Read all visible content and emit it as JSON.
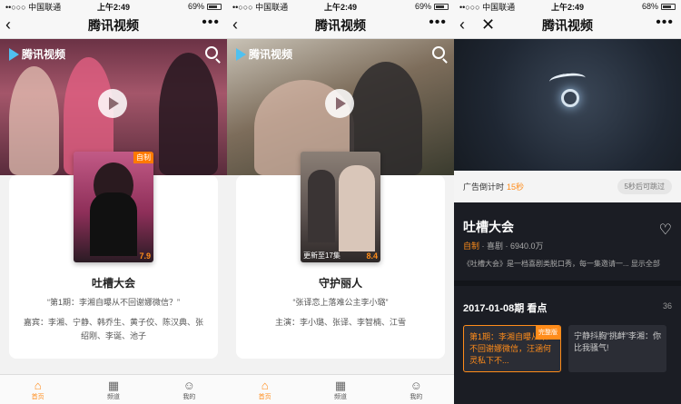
{
  "statusbar": {
    "s1": {
      "carrier": "••○○○ 中国联通",
      "time": "上午2:49",
      "battery": "69%"
    },
    "s2": {
      "carrier": "••○○○ 中国联通",
      "time": "上午2:49",
      "battery": "69%"
    },
    "s3": {
      "carrier": "••○○○ 中国联通",
      "time": "上午2:49",
      "battery": "68%"
    }
  },
  "nav": {
    "title": "腾讯视频",
    "back": "‹",
    "close": "✕",
    "more": "•••"
  },
  "brand": {
    "logo_text": "腾讯视频"
  },
  "screen1": {
    "poster_tag": "自制",
    "poster_score": "7.9",
    "show_name": "吐槽大会",
    "quote": "“第1期：李湘自曝从不回谢娜微信？”",
    "guests": "嘉宾：李湘、宁静、韩乔生、黄子佼、陈汉典、张绍刚、李诞、池子"
  },
  "screen2": {
    "poster_update": "更新至17集",
    "poster_score": "8.4",
    "show_name": "守护丽人",
    "quote": "“张译恋上落难公主李小璐”",
    "cast": "主演：李小璐、张译、李智楠、江雪"
  },
  "tabbar": {
    "home": "首页",
    "channels": "频道",
    "mine": "我的"
  },
  "screen3": {
    "ad_prefix": "广告倒计时",
    "ad_countdown": "15秒",
    "skip": "5秒后可跳过",
    "title": "吐槽大会",
    "meta_original": "自制",
    "meta_rest": "· 喜剧 · 6940.0万",
    "desc": "《吐槽大会》是一档喜剧类脱口秀，每一集邀请一... 显示全部",
    "section": "2017-01-08期  看点",
    "count": "36",
    "episodes": [
      {
        "text": "第1期：李湘自曝从来不回谢娜微信，汪涵何灵私下不...",
        "badge": "完整版"
      },
      {
        "text": "宁静抖胸“挑衅”李湘：你比我骚气!",
        "badge": ""
      }
    ]
  },
  "colors": {
    "accent": "#ff8c1a",
    "dark_bg": "#1b1d24"
  }
}
